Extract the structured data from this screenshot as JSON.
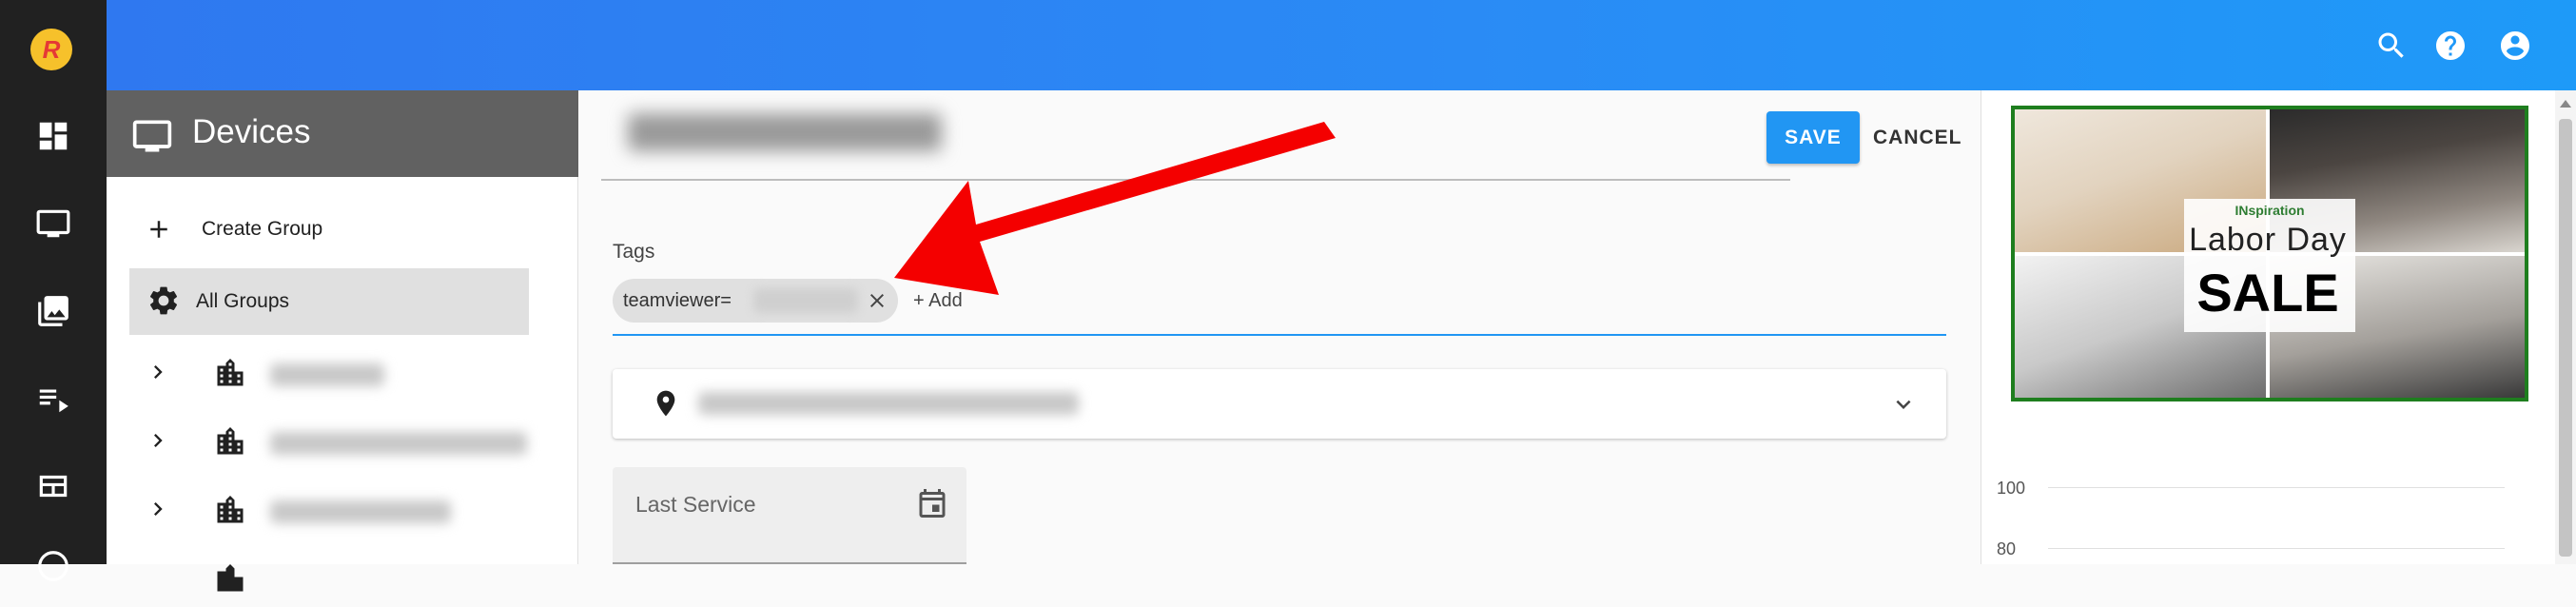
{
  "devices_panel": {
    "title": "Devices",
    "create_group_label": "Create Group",
    "all_groups_label": "All Groups"
  },
  "actions": {
    "save_label": "SAVE",
    "cancel_label": "CANCEL"
  },
  "form": {
    "tags_label": "Tags",
    "tag_chip_text": "teamviewer=",
    "add_tag_label": "+ Add",
    "last_service_placeholder": "Last Service"
  },
  "ad": {
    "brand": "INspiration",
    "line1": "Labor Day",
    "line2": "SALE"
  },
  "chart_axis": {
    "tick_100": "100",
    "tick_80": "80"
  },
  "colors": {
    "accent": "#2196f3",
    "rail": "#212121",
    "annotation_arrow": "#f40000",
    "ad_border": "#1e7e1e"
  }
}
